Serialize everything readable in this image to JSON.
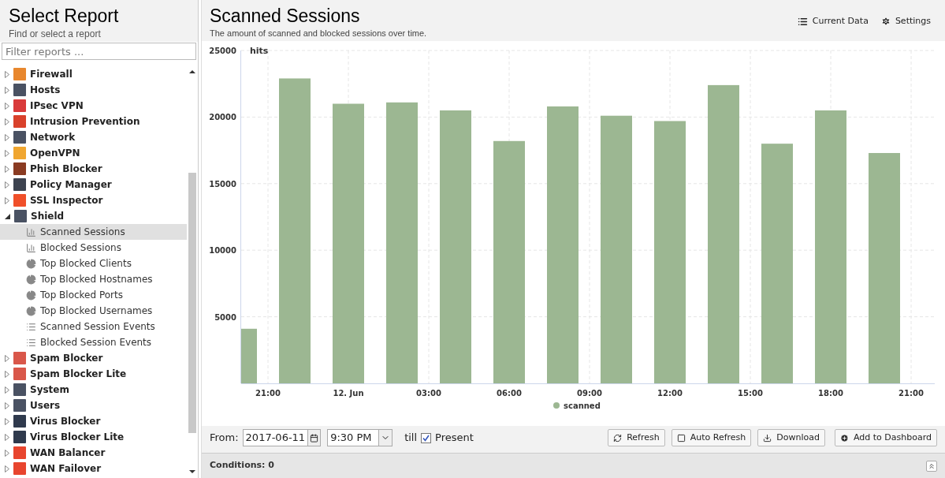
{
  "sidebar": {
    "title": "Select Report",
    "subtitle": "Find or select a report",
    "filter": {
      "placeholder": "Filter reports ..."
    },
    "items": [
      {
        "label": "Firewall",
        "color": "#e8872e",
        "expanded": false,
        "selected": false
      },
      {
        "label": "Hosts",
        "color": "#4a5263",
        "expanded": false,
        "selected": false
      },
      {
        "label": "IPsec VPN",
        "color": "#d93a3a",
        "expanded": false,
        "selected": false
      },
      {
        "label": "Intrusion Prevention",
        "color": "#d9412b",
        "expanded": false,
        "selected": false
      },
      {
        "label": "Network",
        "color": "#4a5263",
        "expanded": false,
        "selected": false
      },
      {
        "label": "OpenVPN",
        "color": "#f0a630",
        "expanded": false,
        "selected": false
      },
      {
        "label": "Phish Blocker",
        "color": "#8a3b22",
        "expanded": false,
        "selected": false
      },
      {
        "label": "Policy Manager",
        "color": "#3d4350",
        "expanded": false,
        "selected": false
      },
      {
        "label": "SSL Inspector",
        "color": "#f0502a",
        "expanded": false,
        "selected": false
      },
      {
        "label": "Shield",
        "color": "#4a5263",
        "expanded": true,
        "selected": false,
        "children": [
          {
            "label": "Scanned Sessions",
            "kind": "bar",
            "selected": true
          },
          {
            "label": "Blocked Sessions",
            "kind": "bar",
            "selected": false
          },
          {
            "label": "Top Blocked Clients",
            "kind": "pie",
            "selected": false
          },
          {
            "label": "Top Blocked Hostnames",
            "kind": "pie",
            "selected": false
          },
          {
            "label": "Top Blocked Ports",
            "kind": "pie",
            "selected": false
          },
          {
            "label": "Top Blocked Usernames",
            "kind": "pie",
            "selected": false
          },
          {
            "label": "Scanned Session Events",
            "kind": "list",
            "selected": false
          },
          {
            "label": "Blocked Session Events",
            "kind": "list",
            "selected": false
          }
        ]
      },
      {
        "label": "Spam Blocker",
        "color": "#d9574a",
        "expanded": false,
        "selected": false
      },
      {
        "label": "Spam Blocker Lite",
        "color": "#d9574a",
        "expanded": false,
        "selected": false
      },
      {
        "label": "System",
        "color": "#4a5263",
        "expanded": false,
        "selected": false
      },
      {
        "label": "Users",
        "color": "#4a5263",
        "expanded": false,
        "selected": false
      },
      {
        "label": "Virus Blocker",
        "color": "#2f3a4d",
        "expanded": false,
        "selected": false
      },
      {
        "label": "Virus Blocker Lite",
        "color": "#2f3a4d",
        "expanded": false,
        "selected": false
      },
      {
        "label": "WAN Balancer",
        "color": "#e8452e",
        "expanded": false,
        "selected": false
      },
      {
        "label": "WAN Failover",
        "color": "#e8452e",
        "expanded": false,
        "selected": false
      }
    ]
  },
  "report": {
    "title": "Scanned Sessions",
    "description": "The amount of scanned and blocked sessions over time.",
    "actions": [
      "Current Data",
      "Settings"
    ],
    "chart_data": {
      "type": "bar",
      "grid": true,
      "ylabel": "hits",
      "ylim": [
        0,
        25000
      ],
      "yticks": [
        5000,
        10000,
        15000,
        20000,
        25000
      ],
      "categories": [
        null,
        "21:00",
        null,
        null,
        "12. Jun",
        null,
        null,
        "03:00",
        null,
        null,
        "06:00",
        null,
        null,
        "09:00",
        null,
        null,
        "12:00",
        null,
        null,
        "15:00",
        null,
        null,
        "18:00",
        null,
        null,
        "21:00"
      ],
      "series": [
        {
          "name": "scanned",
          "color": "#9cb792",
          "values": [
            4100,
            null,
            22900,
            null,
            21000,
            null,
            21100,
            null,
            20500,
            null,
            18200,
            null,
            20800,
            null,
            20100,
            null,
            19700,
            null,
            22400,
            null,
            18000,
            null,
            20500,
            null,
            17300,
            null
          ]
        }
      ]
    }
  },
  "toolbar": {
    "from_label": "From:",
    "date": "2017-06-11",
    "time": "9:30 PM",
    "till_label": "till",
    "present": {
      "label": "Present",
      "checked": true
    },
    "buttons": [
      {
        "label": "Refresh",
        "kind": "refresh"
      },
      {
        "label": "Auto Refresh",
        "kind": "checkbox"
      },
      {
        "label": "Download",
        "kind": "download"
      },
      {
        "label": "Add to Dashboard",
        "kind": "add"
      }
    ]
  },
  "conditions": {
    "label": "Conditions: 0"
  }
}
